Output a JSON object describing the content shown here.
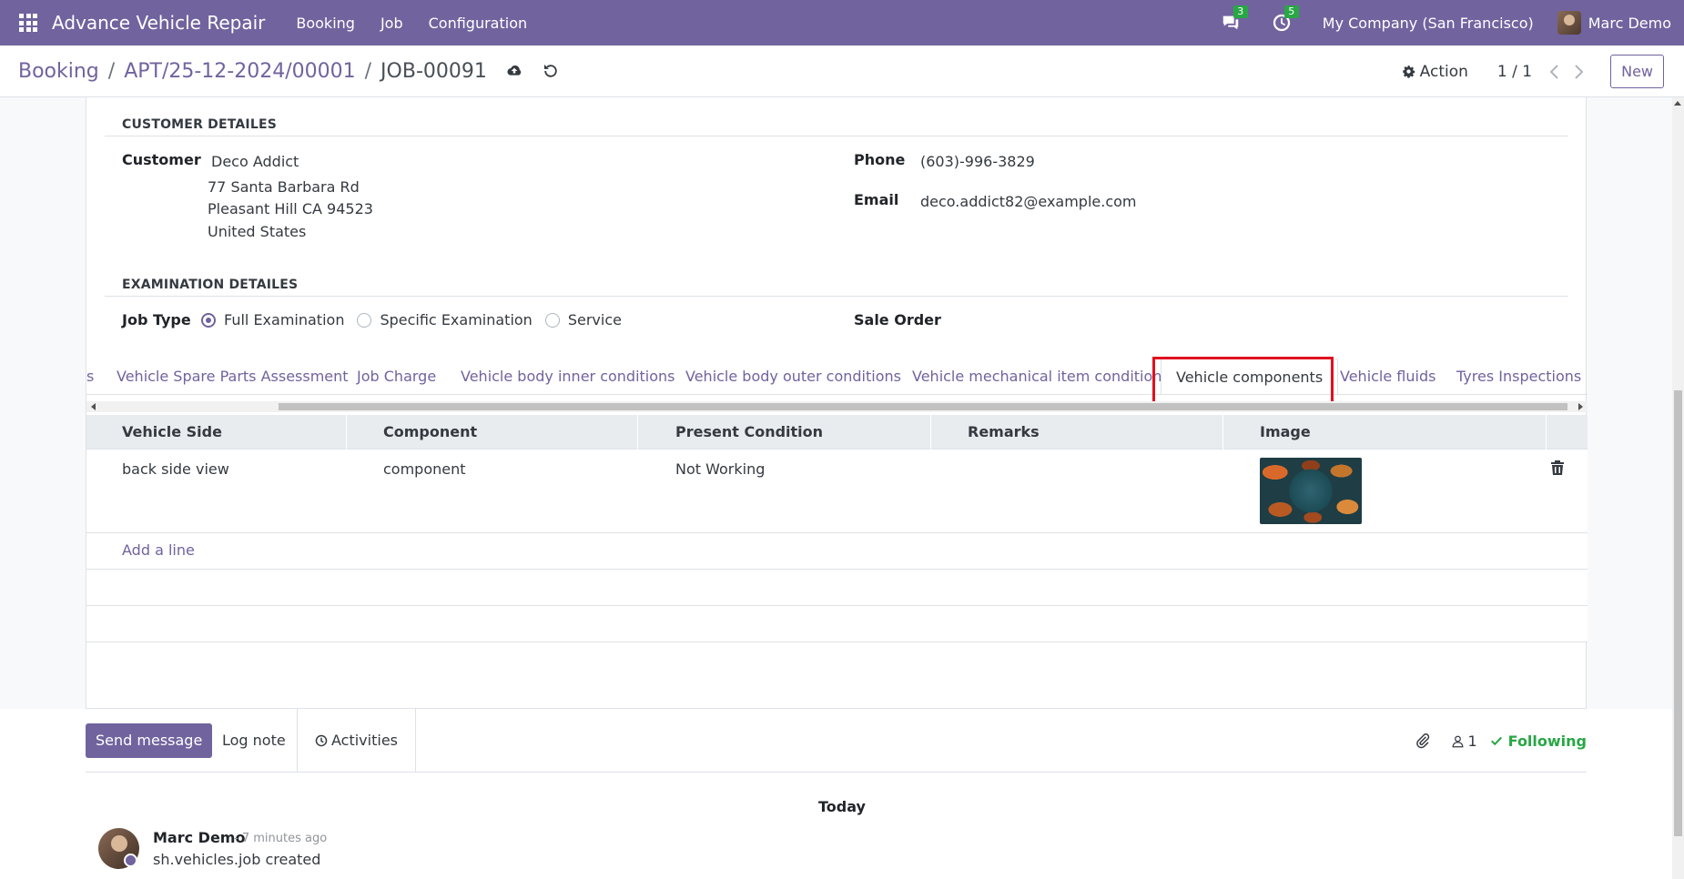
{
  "navbar": {
    "brand": "Advance Vehicle Repair",
    "menu": [
      "Booking",
      "Job",
      "Configuration"
    ],
    "messages_count": "3",
    "activities_count": "5",
    "company": "My Company (San Francisco)",
    "user": "Marc Demo"
  },
  "breadcrumb": {
    "root": "Booking",
    "sep": "/",
    "middle": "APT/25-12-2024/00001",
    "current": "JOB-00091"
  },
  "control": {
    "action_label": "Action",
    "pager": "1 / 1",
    "new_label": "New"
  },
  "customer_section": {
    "title": "CUSTOMER DETAILES",
    "customer_label": "Customer",
    "customer_name": "Deco Addict",
    "address_line1": "77 Santa Barbara Rd",
    "address_line2": "Pleasant Hill CA 94523",
    "address_line3": "United States",
    "phone_label": "Phone",
    "phone": "(603)-996-3829",
    "email_label": "Email",
    "email": "deco.addict82@example.com"
  },
  "examination_section": {
    "title": "EXAMINATION DETAILES",
    "job_type_label": "Job Type",
    "job_types": [
      "Full Examination",
      "Specific Examination",
      "Service"
    ],
    "selected_job_type": "Full Examination",
    "sale_order_label": "Sale Order"
  },
  "tabs": [
    {
      "label": "s"
    },
    {
      "label": "Vehicle Spare Parts Assessment"
    },
    {
      "label": "Job Charge"
    },
    {
      "label": "Vehicle body inner conditions"
    },
    {
      "label": "Vehicle body outer conditions"
    },
    {
      "label": "Vehicle mechanical item conditions"
    },
    {
      "label": "Vehicle components"
    },
    {
      "label": "Vehicle fluids"
    },
    {
      "label": "Tyres Inspections"
    }
  ],
  "active_tab": "Vehicle components",
  "table": {
    "headers": [
      "Vehicle Side",
      "Component",
      "Present Condition",
      "Remarks",
      "Image"
    ],
    "rows": [
      {
        "vehicle_side": "back side view",
        "component": "component",
        "present_condition": "Not Working",
        "remarks": ""
      }
    ],
    "add_line_label": "Add a line"
  },
  "chatter": {
    "send_message_label": "Send message",
    "log_note_label": "Log note",
    "activities_label": "Activities",
    "followers_count": "1",
    "following_label": "Following",
    "date_separator": "Today",
    "message": {
      "author": "Marc Demo",
      "time": "- 7 minutes ago",
      "body": "sh.vehicles.job created"
    }
  },
  "colors": {
    "brand": "#71639e",
    "following": "#28a745",
    "badge": "#28a745",
    "highlight": "#e0101f"
  }
}
